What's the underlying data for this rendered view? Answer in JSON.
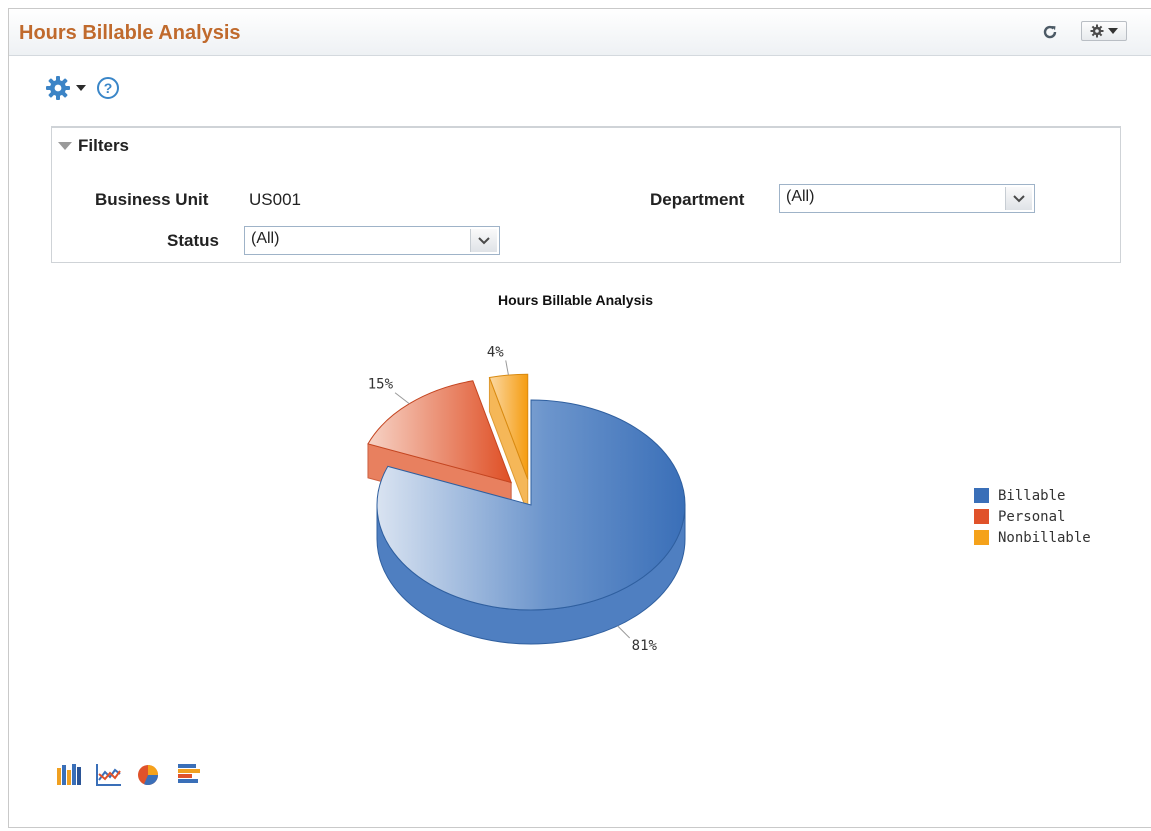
{
  "pagelet": {
    "title": "Hours Billable Analysis"
  },
  "toolbar": {
    "help_label": "?"
  },
  "filters": {
    "header": "Filters",
    "business_unit_label": "Business Unit",
    "business_unit_value": "US001",
    "department_label": "Department",
    "department_value": "(All)",
    "status_label": "Status",
    "status_value": "(All)"
  },
  "colors": {
    "billable": "#3a6fb8",
    "personal": "#e0522a",
    "nonbillable": "#f5a21a",
    "title": "#c06a2d"
  },
  "chart_data": {
    "type": "pie",
    "title": "Hours Billable Analysis",
    "categories": [
      "Billable",
      "Personal",
      "Nonbillable"
    ],
    "values": [
      81,
      15,
      4
    ],
    "labels": [
      "81%",
      "15%",
      "4%"
    ],
    "legend": "right"
  },
  "chart_type_icons": [
    "bar-chart-icon",
    "line-chart-icon",
    "pie-chart-icon",
    "horizontal-bar-chart-icon"
  ]
}
